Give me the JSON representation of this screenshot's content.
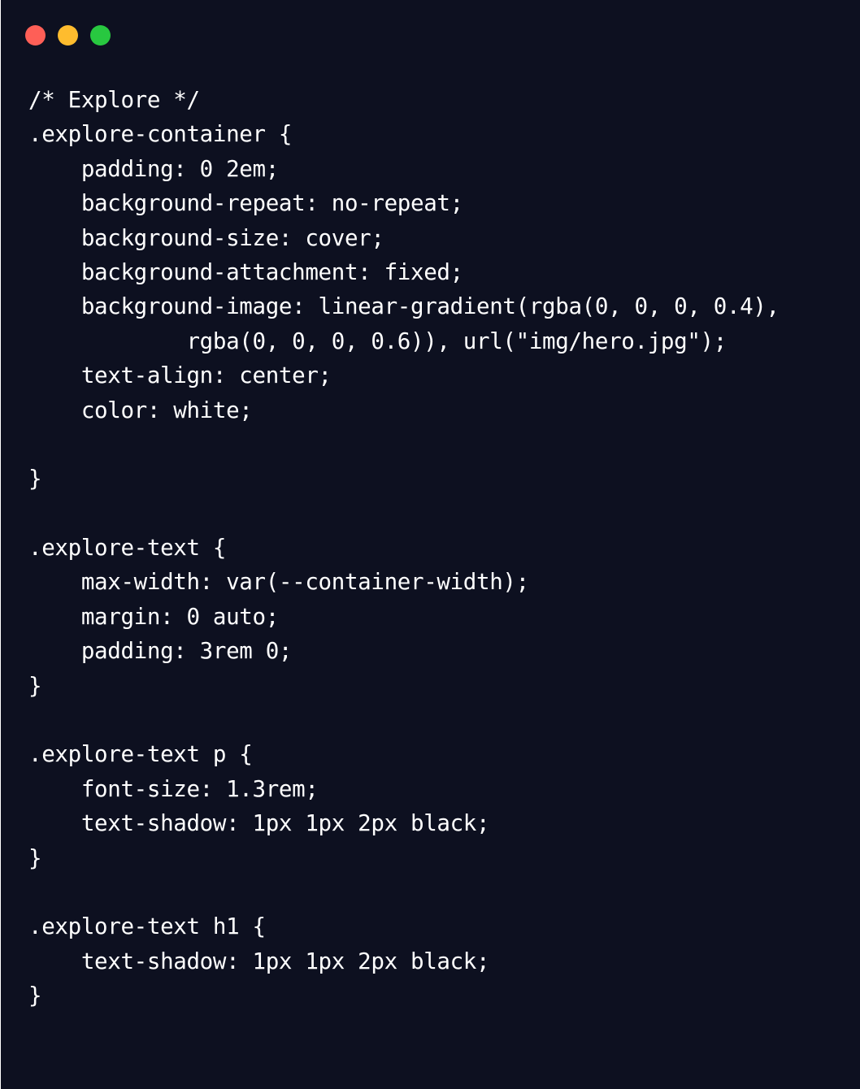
{
  "window": {
    "background": "#0d1020",
    "text_color": "#ffffff",
    "traffic_lights": [
      {
        "name": "close",
        "color": "#fe5f57"
      },
      {
        "name": "minimize",
        "color": "#febc2e"
      },
      {
        "name": "zoom",
        "color": "#28c840"
      }
    ]
  },
  "code": {
    "language": "css",
    "lines": [
      "/* Explore */",
      ".explore-container {",
      "    padding: 0 2em;",
      "    background-repeat: no-repeat;",
      "    background-size: cover;",
      "    background-attachment: fixed;",
      "    background-image: linear-gradient(rgba(0, 0, 0, 0.4),",
      "            rgba(0, 0, 0, 0.6)), url(\"img/hero.jpg\");",
      "    text-align: center;",
      "    color: white;",
      "",
      "}",
      "",
      ".explore-text {",
      "    max-width: var(--container-width);",
      "    margin: 0 auto;",
      "    padding: 3rem 0;",
      "}",
      "",
      ".explore-text p {",
      "    font-size: 1.3rem;",
      "    text-shadow: 1px 1px 2px black;",
      "}",
      "",
      ".explore-text h1 {",
      "    text-shadow: 1px 1px 2px black;",
      "}"
    ]
  }
}
